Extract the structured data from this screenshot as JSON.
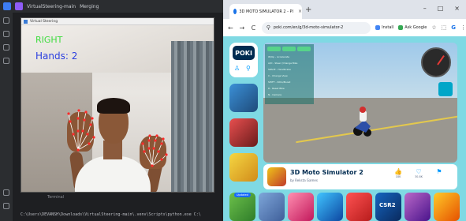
{
  "ide": {
    "title_tabs": [
      "VirtualSteering-main",
      "Merging"
    ],
    "camera_window_title": "Virtual Steering",
    "terminal_tab": "Terminal",
    "terminal_line": "C:\\Users\\DEVANSH\\Downloads\\VirtualSteering-main\\.venv\\Scripts\\python.exe C:\\"
  },
  "camera": {
    "gesture_text": "RIGHT",
    "hands_text": "Hands: 2",
    "gesture_color": "#3fdc3f",
    "hands_color": "#2b3fe0",
    "landmark_color": "#ff2a2a"
  },
  "browser": {
    "tab_label": "3D MOTO SIMULATOR 2 - Pl",
    "tab_close": "×",
    "new_tab": "+",
    "win_controls": [
      "–",
      "□",
      "×"
    ],
    "nav": {
      "back": "←",
      "forward": "→",
      "reload": "C",
      "site_info": "⚲"
    },
    "url": "poki.com/en/g/3d-moto-simulator-2",
    "install_label": "Install",
    "ask_google_label": "Ask Google",
    "star": "☆",
    "extensions": "⬚",
    "profile": "G",
    "menu": "⋮"
  },
  "poki": {
    "logo": "POKI",
    "user_icon": "♙",
    "search_icon": "⚲",
    "game_name": "3D Moto Simulator 2",
    "developer": "by Reksta Games",
    "stats": [
      {
        "icon": "👍",
        "value": "18K"
      },
      {
        "icon": "♡",
        "value": "30.8K"
      },
      {
        "icon": "⚑",
        "value": ""
      }
    ],
    "related_badge": "Updated",
    "related_labels": [
      "CSR2"
    ],
    "game_controls": [
      "W/Up - Accelerate",
      "A/D - Steer (Change Bike",
      "SPACE - Handbrake",
      "C - Change View",
      "SHIFT - Nitro/Boost",
      "R - Reset Bike",
      "N - Camera"
    ]
  }
}
